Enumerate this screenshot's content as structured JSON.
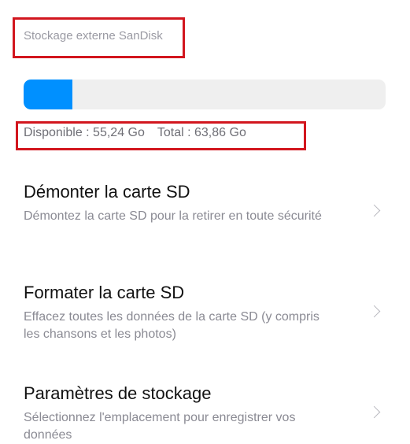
{
  "header": {
    "title": "Stockage externe SanDisk"
  },
  "storage": {
    "used_fraction": 0.135,
    "bar_color": "#0090ff",
    "available_label": "Disponible : 55,24 Go",
    "total_label": "Total : 63,86 Go"
  },
  "highlight_color": "#d2161e",
  "menu": {
    "items": [
      {
        "title": "Démonter la carte SD",
        "description": "Démontez la carte SD pour la retirer en toute sécurité",
        "icon": "chevron-right-icon"
      },
      {
        "title": "Formater la carte SD",
        "description": "Effacez toutes les données de la carte SD (y compris les chansons et les photos)",
        "icon": "chevron-right-icon"
      },
      {
        "title": "Paramètres de stockage",
        "description": "Sélectionnez l'emplacement pour enregistrer vos données",
        "icon": "chevron-right-icon"
      }
    ]
  }
}
